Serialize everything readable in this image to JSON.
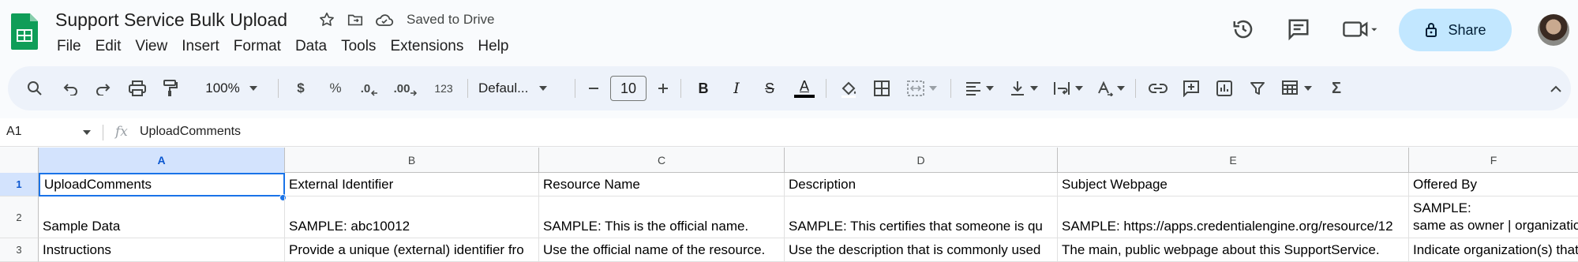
{
  "app": {
    "doc_title": "Support Service Bulk Upload",
    "saved_status": "Saved to Drive",
    "share_label": "Share",
    "brand_color": "#0f9d58",
    "accent_color": "#1a73e8"
  },
  "menu": [
    "File",
    "Edit",
    "View",
    "Insert",
    "Format",
    "Data",
    "Tools",
    "Extensions",
    "Help"
  ],
  "toolbar": {
    "zoom": "100%",
    "currency": "$",
    "percent": "%",
    "decrease_decimals": ".0",
    "increase_decimals": ".00",
    "number_format": "123",
    "font": "Defaul...",
    "font_size": "10",
    "bold": "B",
    "italic": "I",
    "strikethrough": "S",
    "text_color": "A",
    "sum": "Σ"
  },
  "formula_bar": {
    "cell_ref": "A1",
    "fx": "fx",
    "content": "UploadComments"
  },
  "grid": {
    "columns": [
      "A",
      "B",
      "C",
      "D",
      "E",
      "F"
    ],
    "selected_column": "A",
    "rows": [
      {
        "num": "1",
        "cells": [
          "UploadComments",
          "External Identifier",
          "Resource Name",
          "Description",
          "Subject Webpage",
          "Offered By"
        ]
      },
      {
        "num": "2",
        "cells": [
          "Sample Data",
          "SAMPLE: abc10012",
          "SAMPLE: This is the official name.",
          "SAMPLE: This certifies that someone is qu",
          "SAMPLE: https://apps.credentialengine.org/resource/12",
          "SAMPLE:"
        ],
        "extra_F": "same as owner | organization"
      },
      {
        "num": "3",
        "cells": [
          "Instructions",
          "Provide a unique (external) identifier fro",
          "Use the official name of the resource.",
          "Use the description that is commonly used",
          "The main, public webpage about this SupportService.",
          "Indicate organization(s) that"
        ]
      }
    ]
  }
}
